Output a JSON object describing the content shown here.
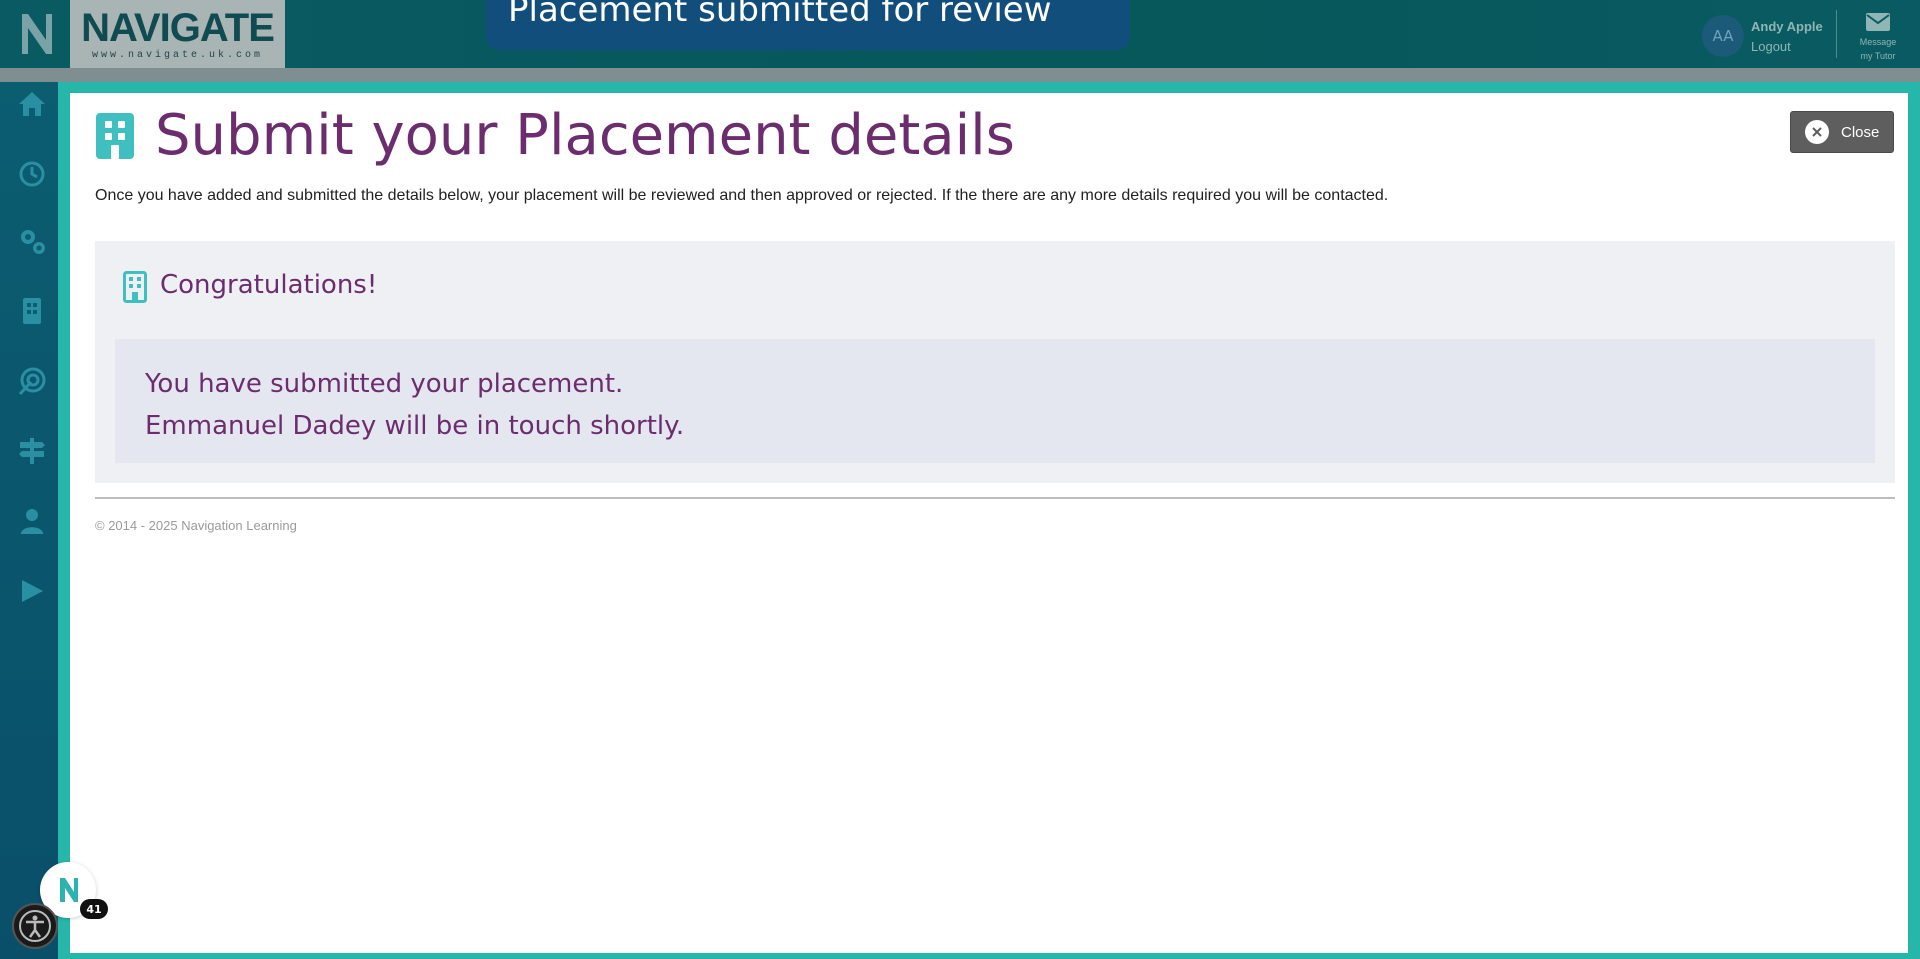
{
  "header": {
    "brand_name": "NAVIGATE",
    "brand_url": "www.navigate.uk.com",
    "toast": "Placement submitted for review",
    "user_initials": "AA",
    "user_name": "Andy Apple",
    "logout": "Logout",
    "message_tutor_line1": "Message",
    "message_tutor_line2": "my Tutor"
  },
  "sidebar": {
    "items": [
      {
        "icon": "home-icon"
      },
      {
        "icon": "clock-icon"
      },
      {
        "icon": "gears-icon"
      },
      {
        "icon": "building-icon"
      },
      {
        "icon": "target-icon"
      },
      {
        "icon": "signpost-icon"
      },
      {
        "icon": "user-icon"
      },
      {
        "icon": "play-icon"
      }
    ]
  },
  "modal": {
    "title": "Submit your Placement details",
    "close_label": "Close",
    "intro": "Once you have added and submitted the details below, your placement will be reviewed and then approved or rejected. If the there are any more details required you will be contacted.",
    "panel_title": "Congratulations!",
    "message_line1": "You have submitted your placement.",
    "message_line2": "Emmanuel Dadey will be in touch shortly.",
    "footer": "© 2014 - 2025 Navigation Learning"
  },
  "widgets": {
    "chat_badge": "41"
  },
  "colors": {
    "teal": "#27b7aa",
    "purple": "#6c2d6e",
    "topbar": "#0a5a63",
    "close_button": "#5e5e5e"
  }
}
